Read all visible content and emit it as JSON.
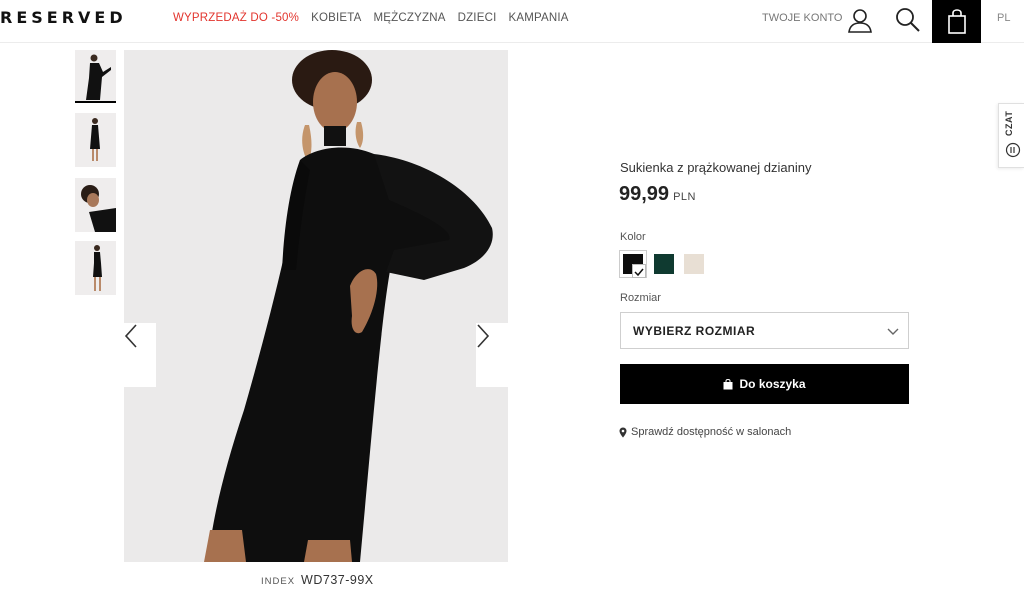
{
  "header": {
    "logo": "RESERVED",
    "nav": [
      {
        "label": "WYPRZEDAŻ DO -50%"
      },
      {
        "label": "KOBIETA"
      },
      {
        "label": "MĘŻCZYZNA"
      },
      {
        "label": "DZIECI"
      },
      {
        "label": "KAMPANIA"
      }
    ],
    "account_label": "TWOJE KONTO",
    "language": "PL"
  },
  "gallery": {
    "index_label": "INDEX",
    "index_value": "WD737-99X"
  },
  "product": {
    "name": "Sukienka z prążkowanej dzianiny",
    "price": "99,99",
    "currency": "PLN",
    "color_label": "Kolor",
    "colors": [
      {
        "name": "black",
        "hex": "#0d0d0d",
        "selected": true
      },
      {
        "name": "dark-green",
        "hex": "#0f3a30",
        "selected": false
      },
      {
        "name": "cream",
        "hex": "#e8dfd4",
        "selected": false
      }
    ],
    "size_label": "Rozmiar",
    "size_placeholder": "WYBIERZ ROZMIAR",
    "add_to_cart": "Do koszyka",
    "store_availability": "Sprawdź dostępność w salonach"
  },
  "chat": {
    "label": "CZAT"
  },
  "colors": {
    "sale": "#e2342d",
    "primary_button": "#000000"
  }
}
